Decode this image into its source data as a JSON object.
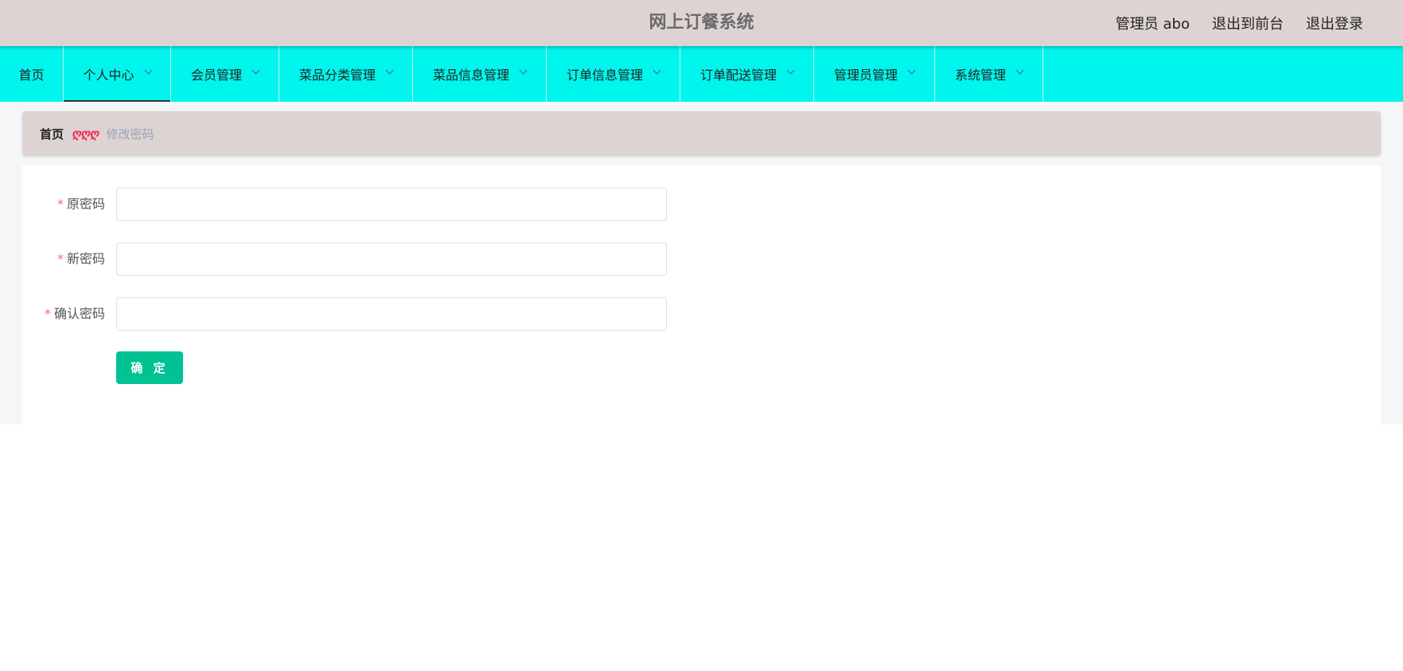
{
  "header": {
    "title": "网上订餐系统",
    "user_label": "管理员 abo",
    "to_front_label": "退出到前台",
    "logout_label": "退出登录"
  },
  "nav": {
    "items": [
      {
        "label": "首页",
        "has_dropdown": false
      },
      {
        "label": "个人中心",
        "has_dropdown": true,
        "active": true
      },
      {
        "label": "会员管理",
        "has_dropdown": true
      },
      {
        "label": "菜品分类管理",
        "has_dropdown": true
      },
      {
        "label": "菜品信息管理",
        "has_dropdown": true
      },
      {
        "label": "订单信息管理",
        "has_dropdown": true
      },
      {
        "label": "订单配送管理",
        "has_dropdown": true
      },
      {
        "label": "管理员管理",
        "has_dropdown": true
      },
      {
        "label": "系统管理",
        "has_dropdown": true
      }
    ]
  },
  "breadcrumb": {
    "home": "首页",
    "separator": "ღღღ",
    "current": "修改密码"
  },
  "form": {
    "required_mark": "*",
    "old_password": {
      "label": "原密码",
      "value": ""
    },
    "new_password": {
      "label": "新密码",
      "value": ""
    },
    "confirm_password": {
      "label": "确认密码",
      "value": ""
    },
    "submit_label": "确 定"
  },
  "colors": {
    "header_bg": "#ded3d3",
    "nav_bg": "#00f5ec",
    "submit_bg": "#00c292",
    "required": "#f56c6c",
    "breadcrumb_sep": "#f0335a"
  },
  "icons": {
    "nav_dropdown": "chevron-down-icon"
  }
}
